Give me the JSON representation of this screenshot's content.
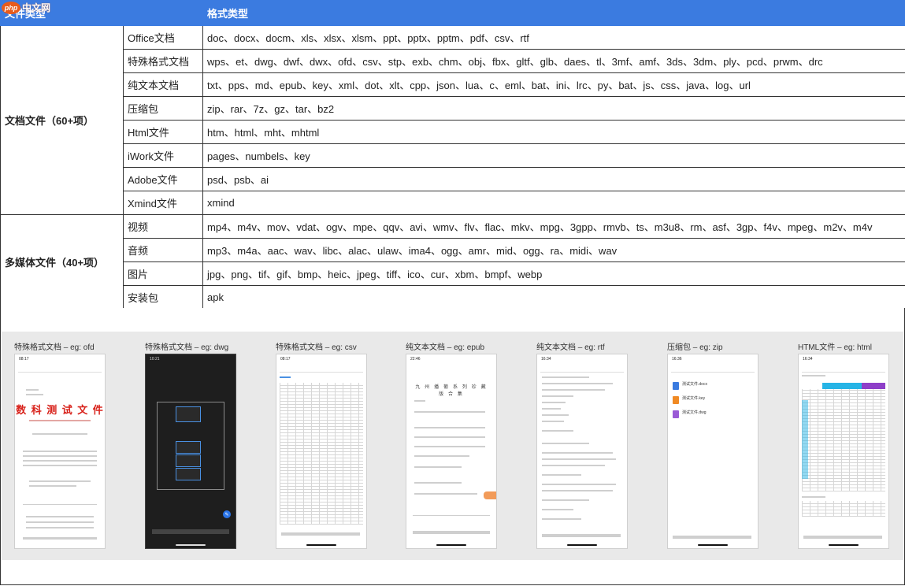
{
  "watermark": {
    "logo": "php",
    "text": "中文网"
  },
  "table": {
    "headers": [
      "文件类型",
      "格式类型"
    ],
    "groups": [
      {
        "name": "文档文件（60+项）",
        "rows": [
          {
            "label": "Office文档",
            "formats": "doc、docx、docm、xls、xlsx、xlsm、ppt、pptx、pptm、pdf、csv、rtf"
          },
          {
            "label": "特殊格式文档",
            "formats": "wps、et、dwg、dwf、dwx、ofd、csv、stp、exb、chm、obj、fbx、gltf、glb、daes、tl、3mf、amf、3ds、3dm、ply、pcd、prwm、drc"
          },
          {
            "label": "纯文本文档",
            "formats": "txt、pps、md、epub、key、xml、dot、xlt、cpp、json、lua、c、eml、bat、ini、lrc、py、bat、js、css、java、log、url"
          },
          {
            "label": "压缩包",
            "formats": "zip、rar、7z、gz、tar、bz2"
          },
          {
            "label": "Html文件",
            "formats": "htm、html、mht、mhtml"
          },
          {
            "label": "iWork文件",
            "formats": "pages、numbels、key"
          },
          {
            "label": "Adobe文件",
            "formats": "psd、psb、ai"
          },
          {
            "label": "Xmind文件",
            "formats": "xmind"
          }
        ]
      },
      {
        "name": "多媒体文件（40+项）",
        "rows": [
          {
            "label": "视频",
            "formats": "mp4、m4v、mov、vdat、ogv、mpe、qqv、avi、wmv、flv、flac、mkv、mpg、3gpp、rmvb、ts、m3u8、rm、asf、3gp、f4v、mpeg、m2v、m4v"
          },
          {
            "label": "音频",
            "formats": "mp3、m4a、aac、wav、libc、alac、ulaw、ima4、ogg、amr、mid、ogg、ra、midi、wav"
          },
          {
            "label": "图片",
            "formats": "jpg、png、tif、gif、bmp、heic、jpeg、tiff、ico、cur、xbm、bmpf、webp"
          },
          {
            "label": "安装包",
            "formats": "apk"
          }
        ]
      }
    ]
  },
  "screenshots": [
    {
      "label": "特殊格式文档 – eg: ofd",
      "icon": "phone-ofd-preview",
      "time": "08:17",
      "headline": "数 科 测 试 文 件"
    },
    {
      "label": "特殊格式文档 – eg: dwg",
      "icon": "phone-dwg-preview",
      "time": "10:21"
    },
    {
      "label": "特殊格式文档 – eg: csv",
      "icon": "phone-csv-preview",
      "time": "08:17"
    },
    {
      "label": "纯文本文档 – eg: epub",
      "icon": "phone-epub-preview",
      "time": "22:46",
      "headline": "九 州 播 葡 系 列 珍 藏 版 合 集"
    },
    {
      "label": "纯文本文档 – eg: rtf",
      "icon": "phone-rtf-preview",
      "time": "16:34"
    },
    {
      "label": "压缩包 – eg: zip",
      "icon": "phone-zip-preview",
      "time": "16:36",
      "files": [
        "测试文件.docx",
        "测试文件.key",
        "测试文件.dwg"
      ]
    },
    {
      "label": "HTML文件 – eg: html",
      "icon": "phone-html-preview",
      "time": "16:34"
    }
  ],
  "colors": {
    "header_bg": "#3b7be0",
    "ofd_red": "#d8211a",
    "html_blue": "#26b4e6",
    "html_purple": "#8e3fc8",
    "epub_orange": "#f29b59"
  }
}
